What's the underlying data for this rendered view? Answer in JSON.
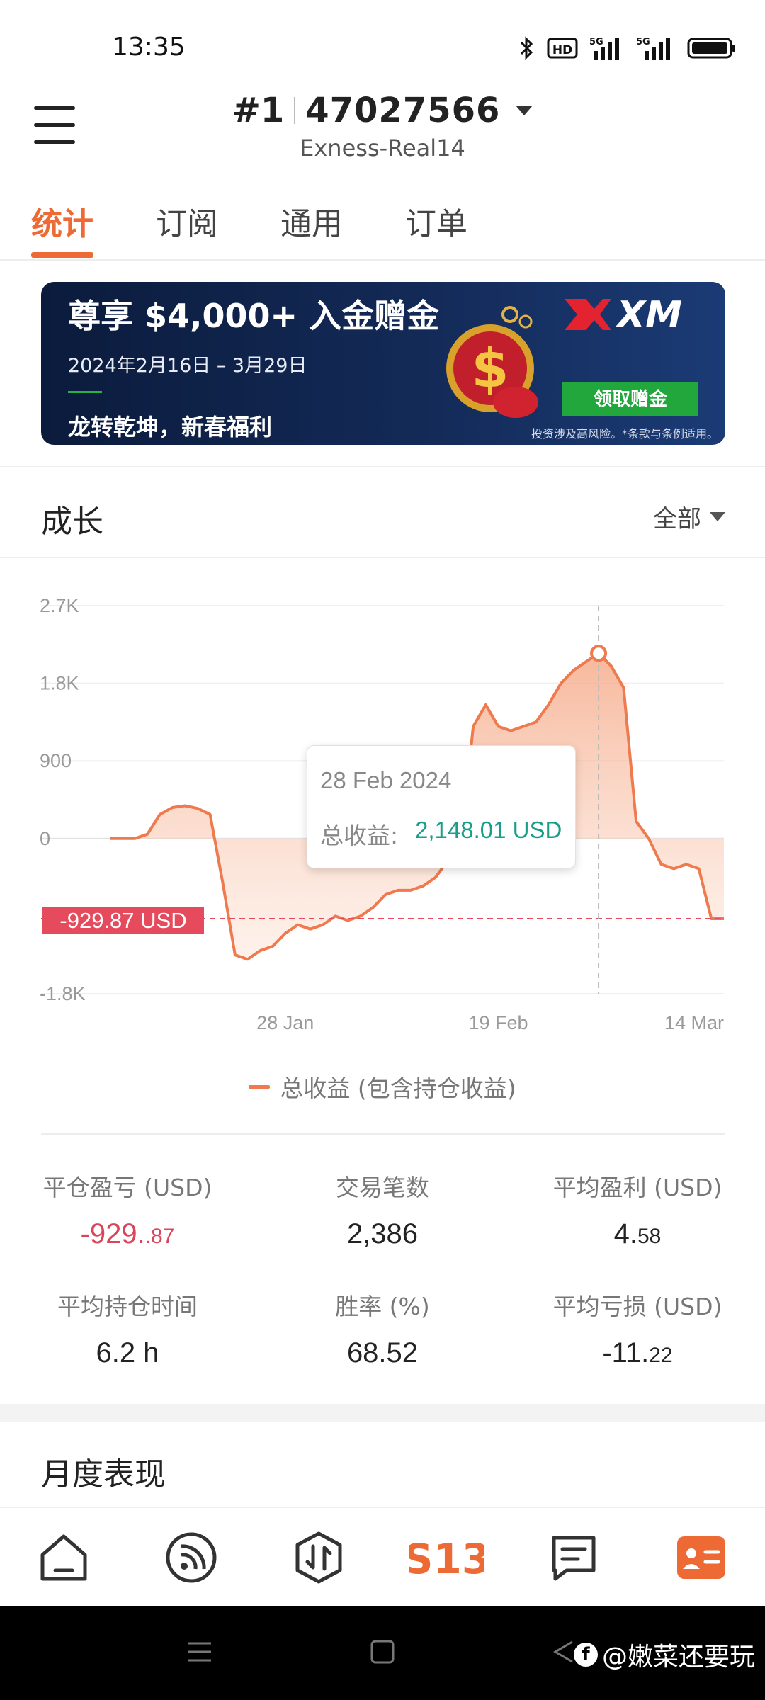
{
  "status_bar": {
    "time": "13:35",
    "hd_label": "HD",
    "signal_label": "5G"
  },
  "header": {
    "rank": "#1",
    "account_number": "47027566",
    "server": "Exness-Real14"
  },
  "tabs": [
    {
      "label": "统计",
      "active": true
    },
    {
      "label": "订阅",
      "active": false
    },
    {
      "label": "通用",
      "active": false
    },
    {
      "label": "订单",
      "active": false
    }
  ],
  "banner": {
    "headline": "尊享 $4,000+ 入金赠金",
    "dates": "2024年2月16日 – 3月29日",
    "slogan": "龙转乾坤，新春福利",
    "logo_text": "XM",
    "cta": "领取赠金",
    "disclaimer": "投资涉及高风险。*条款与条例适用。"
  },
  "growth": {
    "title": "成长",
    "range": "全部",
    "tooltip": {
      "date": "28 Feb 2024",
      "label": "总收益:",
      "value": "2,148.01 USD"
    },
    "current_badge": "-929.87 USD",
    "legend": "总收益 (包含持仓收益)"
  },
  "chart_data": {
    "type": "area",
    "y_ticks": [
      "2.7K",
      "1.8K",
      "900",
      "0",
      "-1.8K"
    ],
    "x_ticks": [
      "28 Jan",
      "19 Feb",
      "14 Mar"
    ],
    "ylim": [
      -1800,
      2700
    ],
    "series": [
      {
        "name": "总收益 (包含持仓收益)",
        "color": "#ee7a4e",
        "values": [
          0,
          0,
          0,
          50,
          280,
          360,
          380,
          350,
          280,
          -500,
          -1350,
          -1400,
          -1300,
          -1250,
          -1100,
          -1000,
          -1050,
          -1000,
          -900,
          -950,
          -900,
          -800,
          -650,
          -600,
          -600,
          -550,
          -450,
          -250,
          -100,
          1300,
          1550,
          1300,
          1250,
          1300,
          1350,
          1550,
          1800,
          1950,
          2050,
          2148.01,
          2000,
          1750,
          200,
          0,
          -300,
          -350,
          -300,
          -350,
          -929.87,
          -929.87
        ]
      }
    ],
    "highlight": {
      "label": "28 Feb 2024",
      "value": 2148.01
    },
    "current_value": -929.87
  },
  "stats": [
    {
      "label": "平仓盈亏 (USD)",
      "main": "-929.",
      "frac": ".87",
      "negative": true
    },
    {
      "label": "交易笔数",
      "main": "2,386",
      "frac": ""
    },
    {
      "label": "平均盈利 (USD)",
      "main": "4.",
      "frac": "58"
    },
    {
      "label": "平均持仓时间",
      "main": "6.2 h",
      "frac": ""
    },
    {
      "label": "胜率 (%)",
      "main": "68.52",
      "frac": ""
    },
    {
      "label": "平均亏损 (USD)",
      "main": "-11.",
      "frac": "22"
    }
  ],
  "monthly": {
    "title": "月度表现"
  },
  "bottom_nav": [
    {
      "icon": "home-icon"
    },
    {
      "icon": "signals-icon"
    },
    {
      "icon": "trade-icon"
    },
    {
      "icon": "s13-logo-icon",
      "label": "S13"
    },
    {
      "icon": "messages-icon"
    },
    {
      "icon": "profile-card-icon",
      "active": true
    }
  ],
  "colors": {
    "accent": "#ee6a35",
    "negative": "#d9455a",
    "positive": "#1a9e8a",
    "banner_green": "#22a73d"
  },
  "watermark": "@嫩菜还要玩"
}
